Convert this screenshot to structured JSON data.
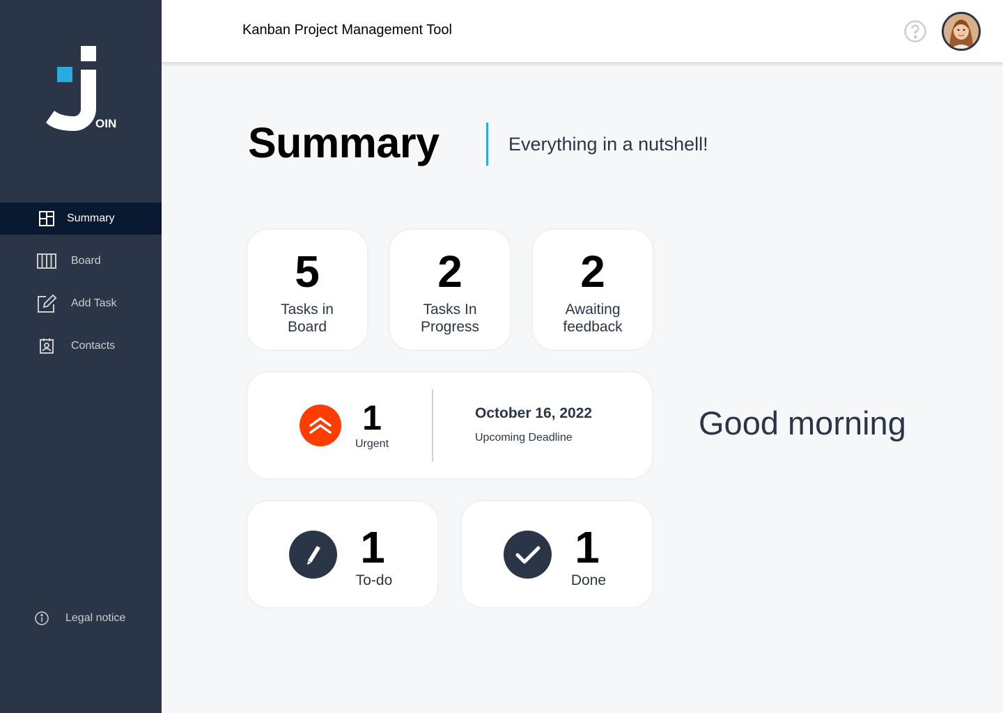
{
  "app": {
    "logo_suffix": "OIN"
  },
  "header": {
    "title": "Kanban Project Management Tool"
  },
  "sidebar": {
    "items": [
      {
        "label": "Summary",
        "icon": "summary-icon",
        "active": true
      },
      {
        "label": "Board",
        "icon": "board-icon",
        "active": false
      },
      {
        "label": "Add Task",
        "icon": "add-task-icon",
        "active": false
      },
      {
        "label": "Contacts",
        "icon": "contacts-icon",
        "active": false
      }
    ],
    "legal": "Legal notice"
  },
  "main": {
    "title": "Summary",
    "subtitle": "Everything in a nutshell!",
    "stats": [
      {
        "value": "5",
        "label": "Tasks in Board"
      },
      {
        "value": "2",
        "label": "Tasks In Progress"
      },
      {
        "value": "2",
        "label": "Awaiting feedback"
      }
    ],
    "urgent": {
      "value": "1",
      "label": "Urgent",
      "deadline_date": "October 16, 2022",
      "deadline_label": "Upcoming Deadline"
    },
    "todo": {
      "value": "1",
      "label": "To-do"
    },
    "done": {
      "value": "1",
      "label": "Done"
    },
    "greeting": "Good morning"
  },
  "colors": {
    "sidebar": "#2A3647",
    "sidebar_active": "#091931",
    "accent": "#29ABE2",
    "urgent": "#FF3D00",
    "background": "#F6F7F8"
  }
}
